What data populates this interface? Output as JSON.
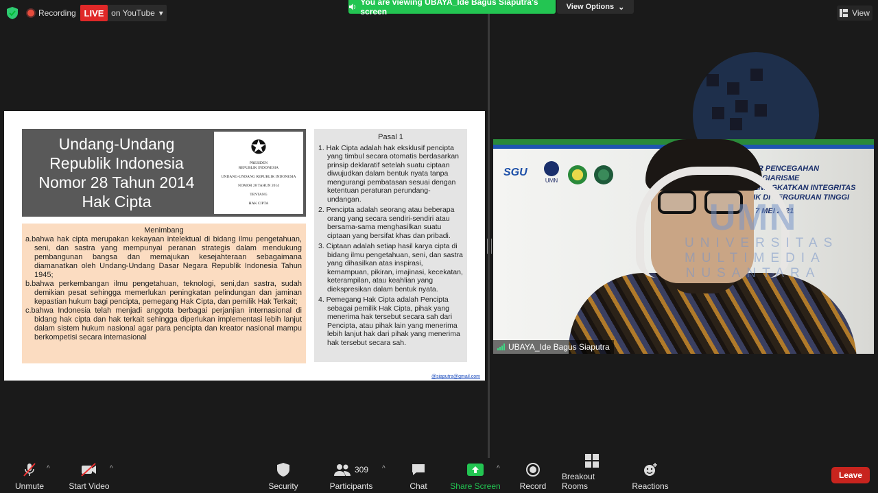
{
  "topbar": {
    "recording": "Recording",
    "live": "LIVE",
    "youtube": "on YouTube",
    "viewing": "You are viewing UBAYA_Ide Bagus Siaputra's screen",
    "view_options": "View Options",
    "view": "View"
  },
  "slide": {
    "title_lines": [
      "Undang-Undang",
      "Republik Indonesia",
      "Nomor 28 Tahun 2014",
      "Hak Cipta"
    ],
    "doc": {
      "line1": "PRESIDEN",
      "line2": "REPUBLIK INDONESIA",
      "line3": "UNDANG-UNDANG REPUBLIK INDONESIA",
      "line4": "NOMOR 28 TAHUN 2014",
      "line5": "TENTANG",
      "line6": "HAK CIPTA"
    },
    "menimbang": {
      "heading": "Menimbang",
      "items": [
        "a.bahwa hak cipta merupakan kekayaan intelektual di bidang ilmu pengetahuan, seni, dan sastra yang mempunyai peranan strategis dalam mendukung pembangunan bangsa dan memajukan kesejahteraan sebagaimana diamanatkan oleh Undang-Undang Dasar Negara Republik Indonesia Tahun 1945;",
        "b.bahwa perkembangan ilmu pengetahuan, teknologi, seni,dan sastra, sudah demikian pesat sehingga memerlukan peningkatan pelindungan dan jaminan kepastian hukum bagi pencipta, pemegang Hak Cipta, dan pemilik Hak Terkait;",
        "c.bahwa Indonesia telah menjadi anggota berbagai perjanjian internasional di bidang hak cipta dan hak terkait sehingga diperlukan implementasi lebih lanjut dalam sistem hukum nasional agar para pencipta dan kreator nasional mampu berkompetisi secara internasional"
      ]
    },
    "pasal": {
      "heading": "Pasal 1",
      "items": [
        "1. Hak Cipta adalah hak eksklusif pencipta yang timbul secara otomatis berdasarkan prinsip deklaratif setelah suatu ciptaan diwujudkan dalam bentuk nyata tanpa mengurangi pembatasan sesuai dengan ketentuan peraturan perundang-undangan.",
        "2. Pencipta adalah seorang atau beberapa orang yang secara sendiri-sendiri atau bersama-sama menghasilkan suatu ciptaan yang bersifat khas dan pribadi.",
        "3. Ciptaan adalah setiap hasil karya cipta di bidang ilmu pengetahuan, seni, dan sastra yang dihasilkan atas inspirasi, kemampuan, pikiran, imajinasi, kecekatan, keterampilan, atau keahlian yang diekspresikan dalam bentuk nyata.",
        "4. Pemegang Hak Cipta adalah Pencipta sebagai pemilik Hak Cipta, pihak yang menerima hak tersebut secara sah dari Pencipta, atau pihak lain yang menerima lebih lanjut hak dari pihak yang menerima hak tersebut secara sah."
      ]
    },
    "email": "@siaputra@gmail.com"
  },
  "video": {
    "name": "UBAYA_Ide Bagus Siaputra",
    "banner_lines": [
      "NAR PENCEGAHAN PLAGIARISME",
      "MENINGKATKAN INTEGRITAS",
      "MIK DI PERGURUAN TINGGI"
    ],
    "date": "T, 7 MEI 2021",
    "logo_sgu": "SGU",
    "logo_umn": "UMN"
  },
  "watermark": {
    "big": "UMN",
    "lines": [
      "UNIVERSITAS",
      "MULTIMEDIA",
      "NUSANTARA"
    ]
  },
  "toolbar": {
    "unmute": "Unmute",
    "start_video": "Start Video",
    "security": "Security",
    "participants": "Participants",
    "participants_count": "309",
    "chat": "Chat",
    "share_screen": "Share Screen",
    "record": "Record",
    "breakout": "Breakout Rooms",
    "reactions": "Reactions",
    "leave": "Leave"
  },
  "colors": {
    "live": "#e02828",
    "share": "#23c552",
    "leave": "#c8241e"
  }
}
